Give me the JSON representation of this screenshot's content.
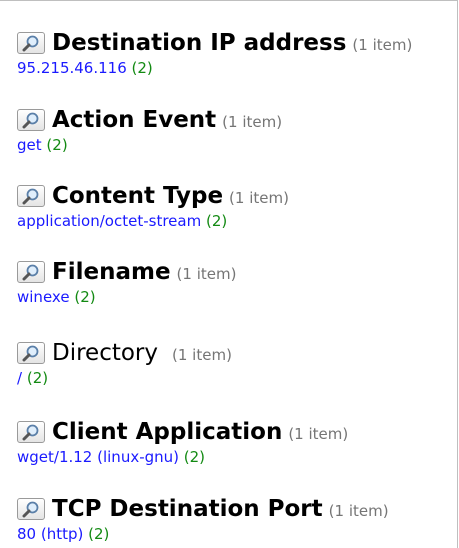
{
  "colors": {
    "value_link": "#1a1aff",
    "value_count": "#138a13",
    "header_count": "#757575"
  },
  "sections": [
    {
      "title": "Destination IP address",
      "count_text": "(1 item)",
      "value": "95.215.46.116",
      "value_count": "(2)",
      "bold": true
    },
    {
      "title": "Action Event",
      "count_text": "(1 item)",
      "value": "get",
      "value_count": "(2)",
      "bold": true
    },
    {
      "title": "Content Type",
      "count_text": "(1 item)",
      "value": "application/octet-stream",
      "value_count": "(2)",
      "bold": true
    },
    {
      "title": "Filename",
      "count_text": "(1 item)",
      "value": "winexe",
      "value_count": "(2)",
      "bold": true
    },
    {
      "title": "Directory",
      "count_text": "(1 item)",
      "value": "/",
      "value_count": "(2)",
      "bold": false
    },
    {
      "title": "Client Application",
      "count_text": "(1 item)",
      "value": "wget/1.12 (linux-gnu)",
      "value_count": "(2)",
      "bold": true
    },
    {
      "title": "TCP Destination Port",
      "count_text": "(1 item)",
      "value": "80 (http)",
      "value_count": "(2)",
      "bold": true
    }
  ]
}
